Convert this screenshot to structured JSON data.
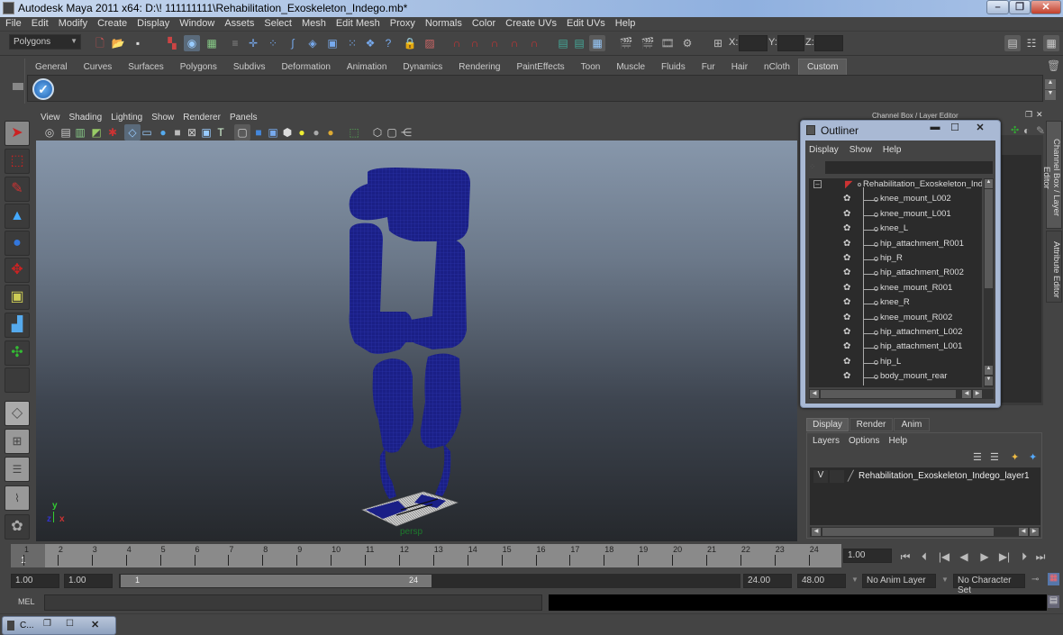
{
  "window": {
    "title": "Autodesk Maya 2011 x64: D:\\! 111111111\\Rehabilitation_Exoskeleton_Indego.mb*",
    "minimize": "–",
    "maximize": "❐",
    "close": "✕"
  },
  "menubar": [
    "File",
    "Edit",
    "Modify",
    "Create",
    "Display",
    "Window",
    "Assets",
    "Select",
    "Mesh",
    "Edit Mesh",
    "Proxy",
    "Normals",
    "Color",
    "Create UVs",
    "Edit UVs",
    "Help"
  ],
  "statusline": {
    "menuset": "Polygons",
    "x_label": "X:",
    "y_label": "Y:",
    "z_label": "Z:",
    "x_value": "",
    "y_value": "",
    "z_value": ""
  },
  "shelf": {
    "tabs": [
      "General",
      "Curves",
      "Surfaces",
      "Polygons",
      "Subdivs",
      "Deformation",
      "Animation",
      "Dynamics",
      "Rendering",
      "PaintEffects",
      "Toon",
      "Muscle",
      "Fluids",
      "Fur",
      "Hair",
      "nCloth",
      "Custom"
    ],
    "active_tab": "Custom"
  },
  "viewport": {
    "menu": [
      "View",
      "Shading",
      "Lighting",
      "Show",
      "Renderer",
      "Panels"
    ],
    "camera_label": "persp",
    "axis": {
      "x": "x",
      "y": "y",
      "z": "z"
    },
    "wire_color": "#1a1f8a"
  },
  "channel_box": {
    "header": "Channel Box / Layer Editor",
    "side_tabs": [
      "Channel Box / Layer Editor",
      "Attribute Editor"
    ]
  },
  "outliner": {
    "title": "Outliner",
    "menu": [
      "Display",
      "Show",
      "Help"
    ],
    "search_value": "",
    "root": "Rehabilitation_Exoskeleton_Indego",
    "items": [
      "knee_mount_L002",
      "knee_mount_L001",
      "knee_L",
      "hip_attachment_R001",
      "hip_R",
      "hip_attachment_R002",
      "knee_mount_R001",
      "knee_R",
      "knee_mount_R002",
      "hip_attachment_L002",
      "hip_attachment_L001",
      "hip_L",
      "body_mount_rear"
    ]
  },
  "layer_editor": {
    "tabs": [
      "Display",
      "Render",
      "Anim"
    ],
    "active_tab": "Display",
    "menu": [
      "Layers",
      "Options",
      "Help"
    ],
    "layers": [
      {
        "visible": "V",
        "name": "Rehabilitation_Exoskeleton_Indego_layer1"
      }
    ]
  },
  "timeline": {
    "ticks": [
      "1",
      "2",
      "3",
      "4",
      "5",
      "6",
      "7",
      "8",
      "9",
      "10",
      "11",
      "12",
      "13",
      "14",
      "15",
      "16",
      "17",
      "18",
      "19",
      "20",
      "21",
      "22",
      "23",
      "24"
    ],
    "current_frame_marker": "1",
    "current_time": "1.00"
  },
  "range": {
    "start_time": "1.00",
    "playback_start": "1.00",
    "slider_start": "1",
    "slider_end": "24",
    "playback_end": "24.00",
    "end_time": "48.00",
    "anim_layer": "No Anim Layer",
    "character_set": "No Character Set"
  },
  "command_line": {
    "label": "MEL",
    "value": "",
    "result": ""
  },
  "minimized_window": {
    "label": "C..."
  }
}
